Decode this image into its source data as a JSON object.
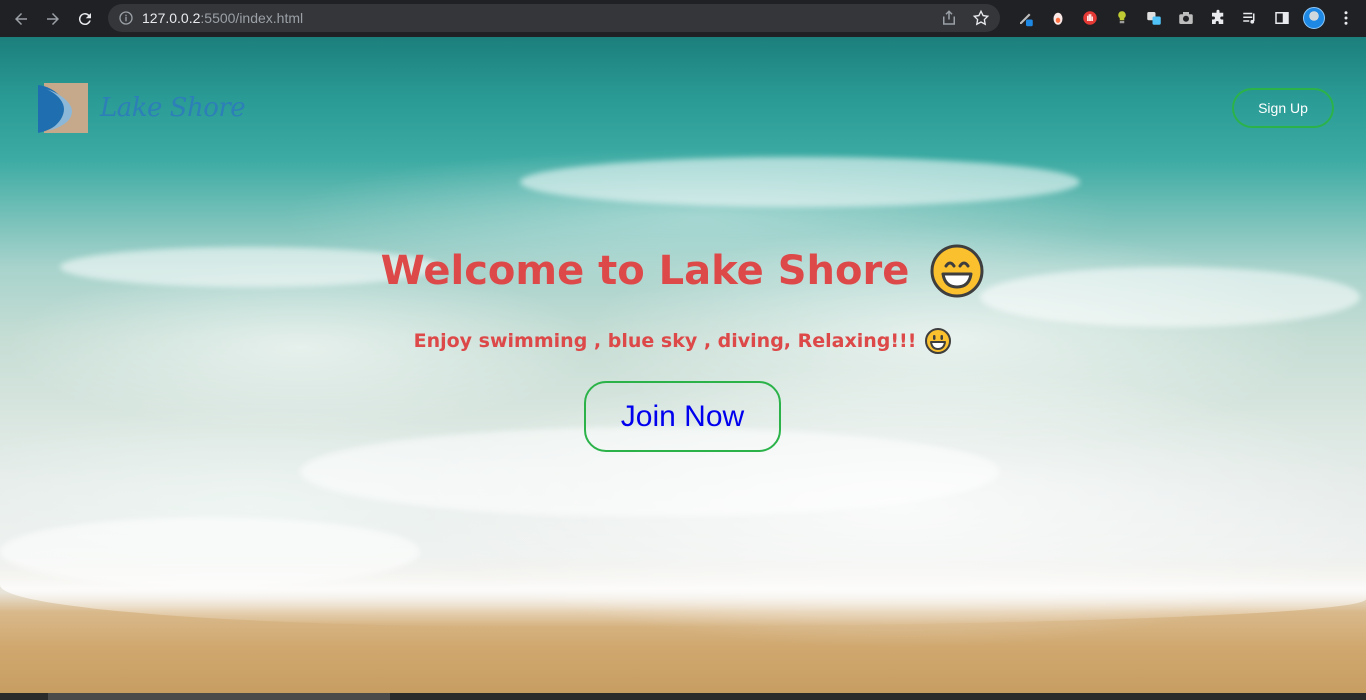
{
  "browser": {
    "url_host": "127.0.0.2",
    "url_path": ":5500/index.html",
    "icons": [
      "back-icon",
      "forward-icon",
      "reload-icon",
      "info-icon",
      "share-icon",
      "star-icon",
      "pen-extension-icon",
      "extension-icon",
      "adblock-icon",
      "idea-extension-icon",
      "translate-extension-icon",
      "camera-extension-icon",
      "puzzle-icon",
      "media-icon",
      "sidepanel-icon",
      "profile-avatar",
      "menu-icon"
    ]
  },
  "header": {
    "logo_text": "Lake Shore",
    "signup_label": "Sign Up"
  },
  "hero": {
    "title": "Welcome to Lake Shore",
    "subtitle": "Enjoy swimming , blue sky , diving, Relaxing!!!",
    "join_label": "Join Now"
  },
  "colors": {
    "hero_text": "#dd4848",
    "button_border": "#2bb34a",
    "join_text": "#0000ee",
    "logo_text": "#2d7fb8"
  }
}
